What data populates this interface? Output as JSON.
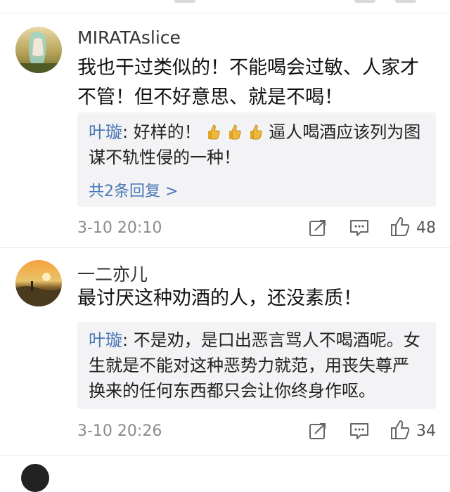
{
  "comments": [
    {
      "username": "MIRATAslice",
      "text": "我也干过类似的！不能喝会过敏、人家才不管！但不好意思、就是不喝！",
      "reply": {
        "author": "叶璇",
        "text": "好样的！",
        "emoji": "thumbs-up",
        "text_after": "逼人喝酒应该列为图谋不轨性侵的一种！",
        "more": "共2条回复 >"
      },
      "time": "3-10 20:10",
      "likes": "48",
      "icons": [
        "forward-icon",
        "comment-icon",
        "like-icon"
      ]
    },
    {
      "username": "一二亦儿",
      "text": "最讨厌这种劝酒的人，还没素质！",
      "reply": {
        "author": "叶璇",
        "text": "不是劝，是口出恶言骂人不喝酒呢。女生就是不能对这种恶势力就范，用丧失尊严换来的任何东西都只会让你终身作呕。"
      },
      "time": "3-10 20:26",
      "likes": "34",
      "icons": [
        "forward-icon",
        "comment-icon",
        "like-icon"
      ]
    }
  ],
  "colors": {
    "link": "#4a78b5",
    "reply_bg": "#f3f3f5",
    "meta": "#8a8a8a"
  }
}
